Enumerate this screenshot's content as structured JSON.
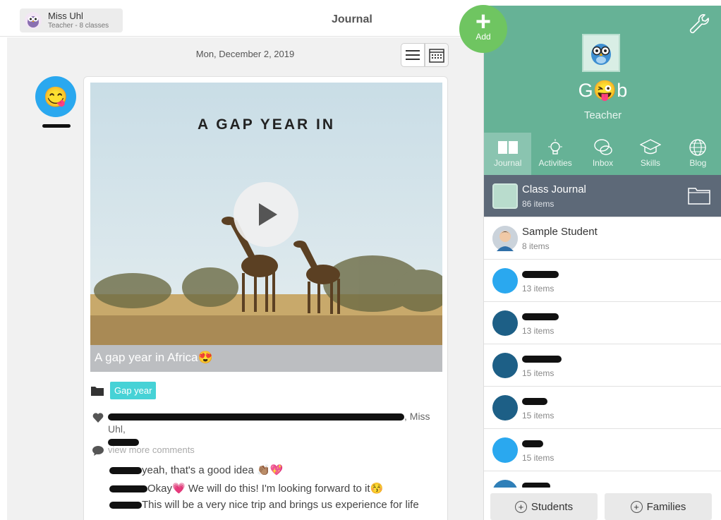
{
  "header": {
    "title": "Journal",
    "account_name": "Miss Uhl",
    "account_sub": "Teacher - 8 classes"
  },
  "add_button": {
    "label": "Add"
  },
  "feed": {
    "date": "Mon, December 2, 2019",
    "post": {
      "video_title": "A GAP YEAR IN",
      "caption": "A gap year in Africa😍",
      "tag": "Gap year",
      "likes_tail": ", Miss Uhl,",
      "view_more": "view more comments",
      "comments": [
        {
          "text": "yeah, that's a good idea 👏🏽💖"
        },
        {
          "text": "Okay💗 We will do this! I'm looking forward to it😚"
        },
        {
          "text": "This will be a very nice trip and brings us experience for life"
        }
      ]
    }
  },
  "panel": {
    "class_name": "G😜b",
    "role": "Teacher",
    "tabs": [
      {
        "label": "Journal",
        "icon": "book-icon"
      },
      {
        "label": "Activities",
        "icon": "lightbulb-icon"
      },
      {
        "label": "Inbox",
        "icon": "chat-icon"
      },
      {
        "label": "Skills",
        "icon": "graduation-cap-icon"
      },
      {
        "label": "Blog",
        "icon": "globe-icon"
      }
    ],
    "class_journal": {
      "name": "Class Journal",
      "count": "86 items"
    },
    "students": [
      {
        "name": "Sample Student",
        "count": "8 items"
      },
      {
        "name": "",
        "count": "13 items"
      },
      {
        "name": "",
        "count": "13 items"
      },
      {
        "name": "",
        "count": "15 items"
      },
      {
        "name": "",
        "count": "15 items"
      },
      {
        "name": "",
        "count": "15 items"
      }
    ],
    "buttons": {
      "students": "Students",
      "families": "Families"
    }
  },
  "colors": {
    "panel_green": "#66b296",
    "fab_green": "#6fc561",
    "tag_teal": "#46d2d6",
    "journal_row": "#5d6978"
  }
}
